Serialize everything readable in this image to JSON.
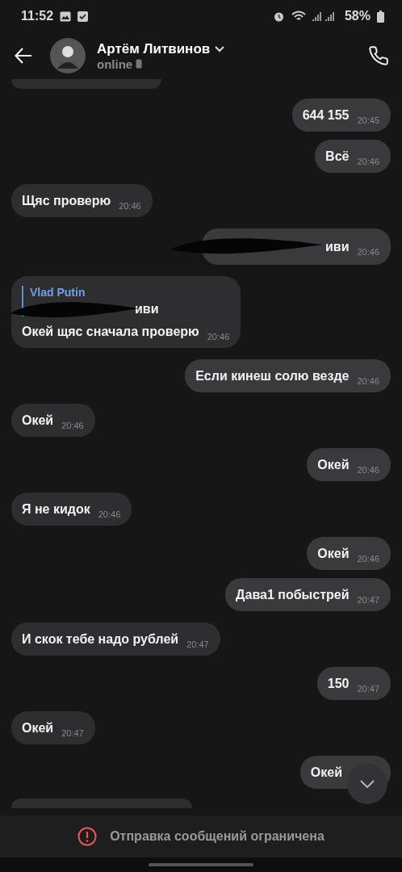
{
  "status_bar": {
    "time": "11:52",
    "battery": "58%"
  },
  "header": {
    "name": "Артём Литвинов",
    "status": "online"
  },
  "messages": [
    {
      "kind": "outgoing",
      "text": "644 155",
      "time": "20:45"
    },
    {
      "kind": "outgoing",
      "text": "Всё",
      "time": "20:46"
    },
    {
      "kind": "incoming",
      "text": "Щяс проверю",
      "time": "20:46"
    },
    {
      "kind": "outgoing",
      "text": "иви",
      "time": "20:46",
      "redacted": true
    },
    {
      "kind": "incoming",
      "text": "Окей щяс сначала проверю",
      "time": "20:46",
      "reply": {
        "author": "Vlad Putin",
        "text": "иви",
        "redacted": true
      }
    },
    {
      "kind": "outgoing",
      "text": "Если кинеш солю везде",
      "time": "20:46"
    },
    {
      "kind": "incoming",
      "text": "Окей",
      "time": "20:46"
    },
    {
      "kind": "outgoing",
      "text": "Окей",
      "time": "20:46"
    },
    {
      "kind": "incoming",
      "text": "Я не кидок",
      "time": "20:46"
    },
    {
      "kind": "outgoing",
      "text": "Окей",
      "time": "20:46"
    },
    {
      "kind": "outgoing",
      "text": "Дава1 побыстрей",
      "time": "20:47"
    },
    {
      "kind": "incoming",
      "text": "И скок тебе надо рублей",
      "time": "20:47"
    },
    {
      "kind": "outgoing",
      "text": "150",
      "time": "20:47"
    },
    {
      "kind": "incoming",
      "text": "Окей",
      "time": "20:47"
    },
    {
      "kind": "outgoing",
      "text": "Окей"
    }
  ],
  "notice": "Отправка сообщений ограничена"
}
